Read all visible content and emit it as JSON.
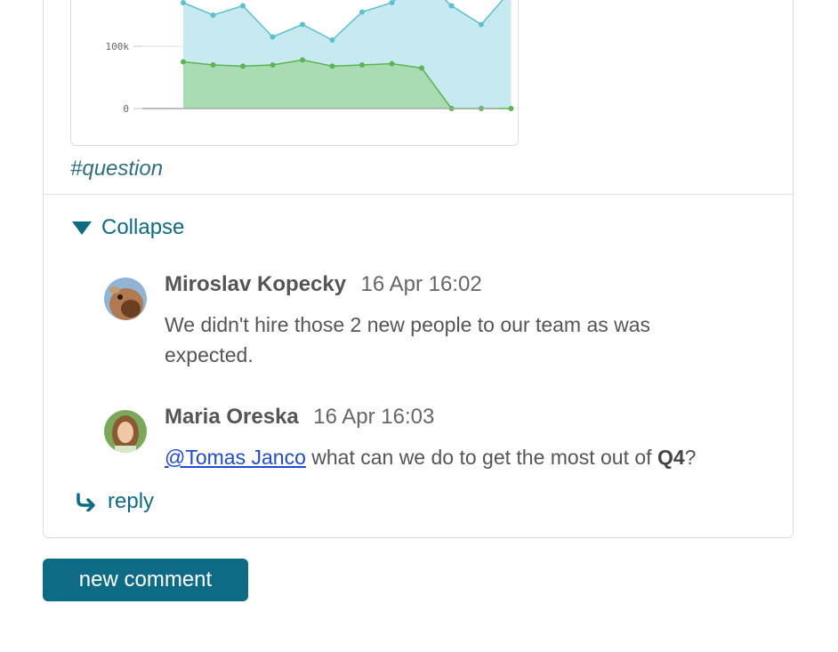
{
  "chart_data": {
    "type": "area",
    "ytick_labels": [
      "100k",
      "0"
    ],
    "series": [
      {
        "values": [
          170000,
          150000,
          165000,
          115000,
          135000,
          110000,
          155000,
          170000,
          210000,
          165000,
          135000,
          190000
        ],
        "color": "#5bc0d0"
      },
      {
        "values": [
          75000,
          70000,
          68000,
          70000,
          78000,
          68000,
          70000,
          72000,
          65000,
          0,
          0,
          0
        ],
        "color": "#5ab552"
      }
    ]
  },
  "post": {
    "tag": "#question"
  },
  "thread": {
    "collapse_label": "Collapse",
    "comments": [
      {
        "author": "Miroslav Kopecky",
        "time": "16 Apr 16:02",
        "text": "We didn't hire those 2 new people to our team as was expected."
      },
      {
        "author": "Maria Oreska",
        "time": "16 Apr 16:03",
        "mention": "@Tomas Janco",
        "text_before_bold": " what can we do to get the most out of ",
        "bold": "Q4",
        "text_after": "?"
      }
    ],
    "reply_label": "reply"
  },
  "actions": {
    "new_comment_label": "new comment"
  },
  "colors": {
    "accent": "#0e6b86",
    "link": "#1f4ad6"
  }
}
